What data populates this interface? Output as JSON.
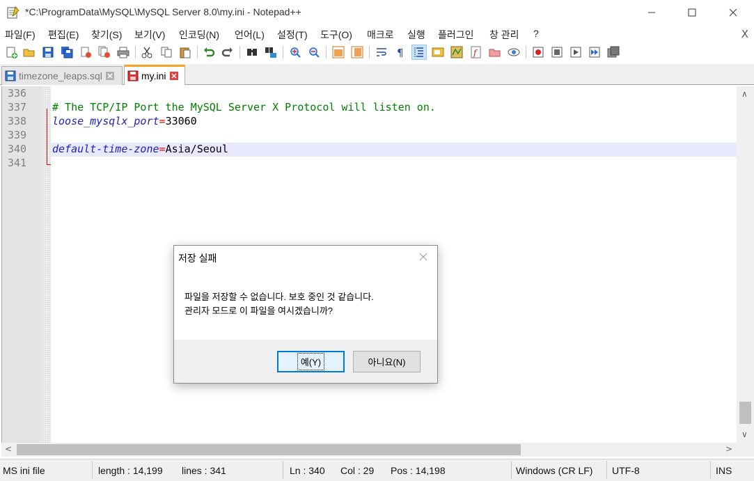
{
  "window": {
    "title": "*C:\\ProgramData\\MySQL\\MySQL Server 8.0\\my.ini - Notepad++",
    "min_icon": "minimize-icon",
    "max_icon": "maximize-icon",
    "close_icon": "close-icon"
  },
  "menu": {
    "items": [
      "파일(F)",
      "편집(E)",
      "찾기(S)",
      "보기(V)",
      "인코딩(N)",
      "언어(L)",
      "설정(T)",
      "도구(O)",
      "매크로",
      "실행",
      "플러그인",
      "창 관리",
      "?"
    ],
    "close": "X"
  },
  "toolbar": {
    "icons": [
      "new-file-icon",
      "open-file-icon",
      "save-icon",
      "save-all-icon",
      "close-icon",
      "close-all-icon",
      "print-icon",
      "cut-icon",
      "copy-icon",
      "paste-icon",
      "undo-icon",
      "redo-icon",
      "find-icon",
      "replace-icon",
      "zoom-in-icon",
      "zoom-out-icon",
      "sync-vertical-icon",
      "sync-horizontal-icon",
      "word-wrap-icon",
      "show-all-chars-icon",
      "indent-guide-icon",
      "language-icon",
      "doc-map-icon",
      "function-list-icon",
      "folder-workspace-icon",
      "monitoring-icon",
      "record-macro-icon",
      "stop-record-icon",
      "play-macro-icon",
      "run-macro-multiple-icon",
      "save-macro-icon"
    ]
  },
  "tabs": [
    {
      "label": "timezone_leaps.sql",
      "active": false
    },
    {
      "label": "my.ini",
      "active": true
    }
  ],
  "editor": {
    "lines": [
      {
        "num": "336",
        "parts": []
      },
      {
        "num": "337",
        "parts": [
          {
            "cls": "cmt",
            "text": "# The TCP/IP Port the MySQL Server X Protocol will listen on."
          }
        ]
      },
      {
        "num": "338",
        "parts": [
          {
            "cls": "key",
            "text": "loose_mysqlx_port"
          },
          {
            "cls": "eq",
            "text": "="
          },
          {
            "cls": "val",
            "text": "33060"
          }
        ]
      },
      {
        "num": "339",
        "parts": []
      },
      {
        "num": "340",
        "parts": [
          {
            "cls": "key",
            "text": "default-time-zone"
          },
          {
            "cls": "eq",
            "text": "="
          },
          {
            "cls": "val",
            "text": "Asia/Seoul"
          }
        ]
      },
      {
        "num": "341",
        "parts": []
      }
    ]
  },
  "status": {
    "filetype": "MS ini file",
    "length": "length : 14,199",
    "lines": "lines : 341",
    "ln": "Ln : 340",
    "col": "Col : 29",
    "pos": "Pos : 14,198",
    "eol": "Windows (CR LF)",
    "encoding": "UTF-8",
    "mode": "INS"
  },
  "dialog": {
    "title": "저장 실패",
    "message_line1": "파일을 저장할 수 없습니다. 보호 중인 것 같습니다.",
    "message_line2": "관리자 모드로 이 파일을 여시겠습니까?",
    "yes_label": "예(Y)",
    "no_label": "아니요(N)"
  },
  "colors": {
    "comment": "#008000",
    "key": "#2020c0",
    "equals": "#ff0000",
    "active_tab_accent": "#f5a623",
    "current_line": "#e8e8ff",
    "default_button_border": "#0078d7"
  }
}
